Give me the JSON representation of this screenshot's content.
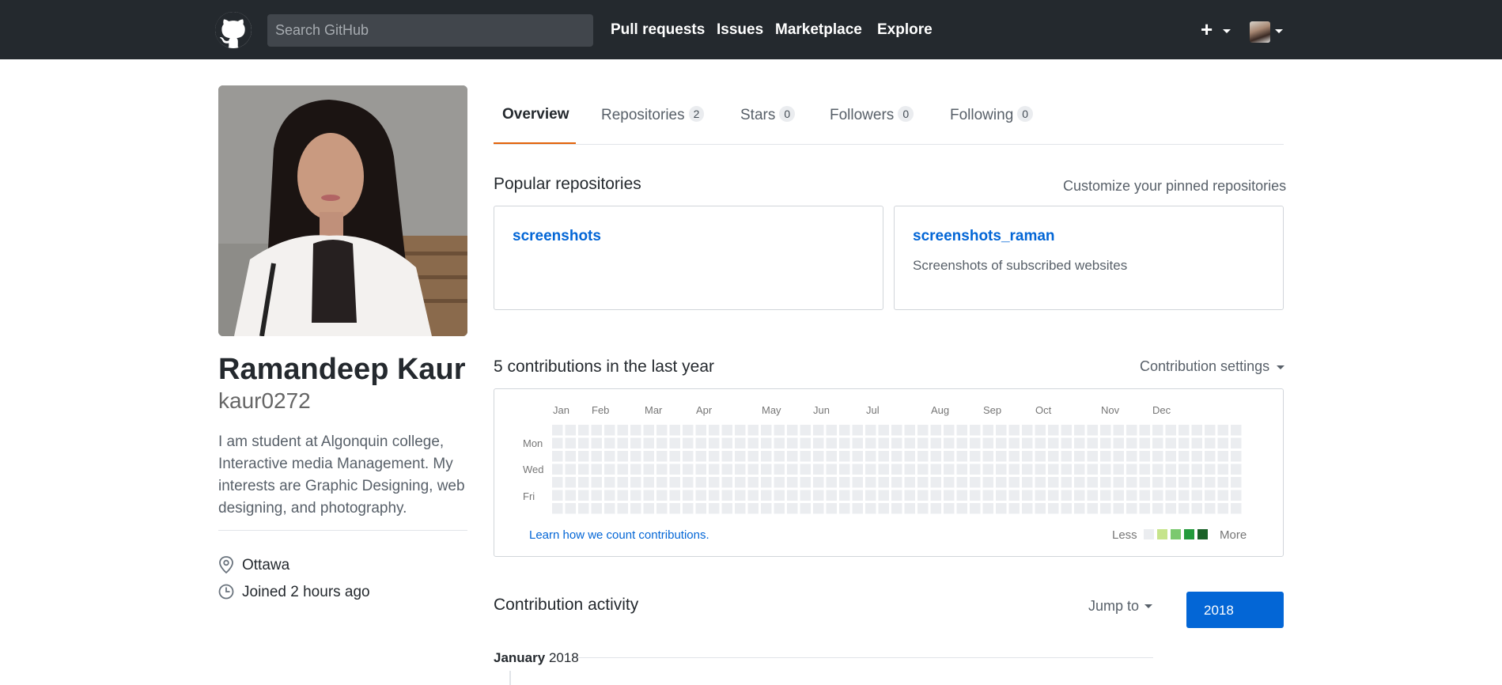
{
  "header": {
    "search_placeholder": "Search GitHub",
    "nav": [
      "Pull requests",
      "Issues",
      "Marketplace",
      "Explore"
    ],
    "plus": "+"
  },
  "profile": {
    "name": "Ramandeep Kaur",
    "username": "kaur0272",
    "bio": "I am student at Algonquin college, Interactive media Management. My interests are Graphic Designing, web designing, and photography.",
    "location": "Ottawa",
    "joined": "Joined 2 hours ago"
  },
  "tabs": [
    {
      "label": "Overview",
      "count": null,
      "active": true
    },
    {
      "label": "Repositories",
      "count": "2"
    },
    {
      "label": "Stars",
      "count": "0"
    },
    {
      "label": "Followers",
      "count": "0"
    },
    {
      "label": "Following",
      "count": "0"
    }
  ],
  "popular": {
    "title": "Popular repositories",
    "customize": "Customize your pinned repositories",
    "repos": [
      {
        "name": "screenshots",
        "description": ""
      },
      {
        "name": "screenshots_raman",
        "description": "Screenshots of subscribed websites"
      }
    ]
  },
  "contributions": {
    "title": "5 contributions in the last year",
    "settings": "Contribution settings",
    "months": [
      "Jan",
      "Feb",
      "Mar",
      "Apr",
      "May",
      "Jun",
      "Jul",
      "Aug",
      "Sep",
      "Oct",
      "Nov",
      "Dec"
    ],
    "days": [
      "Mon",
      "Wed",
      "Fri"
    ],
    "learn": "Learn how we count contributions.",
    "less": "Less",
    "more": "More",
    "colors": [
      "#ebedf0",
      "#c6e48b",
      "#7bc96f",
      "#239a3b",
      "#196127"
    ],
    "active_cell": {
      "week": 53,
      "day": 4,
      "level": 4
    }
  },
  "activity": {
    "title": "Contribution activity",
    "jump": "Jump to",
    "year": "2018",
    "month": "January",
    "month_year": "2018"
  }
}
